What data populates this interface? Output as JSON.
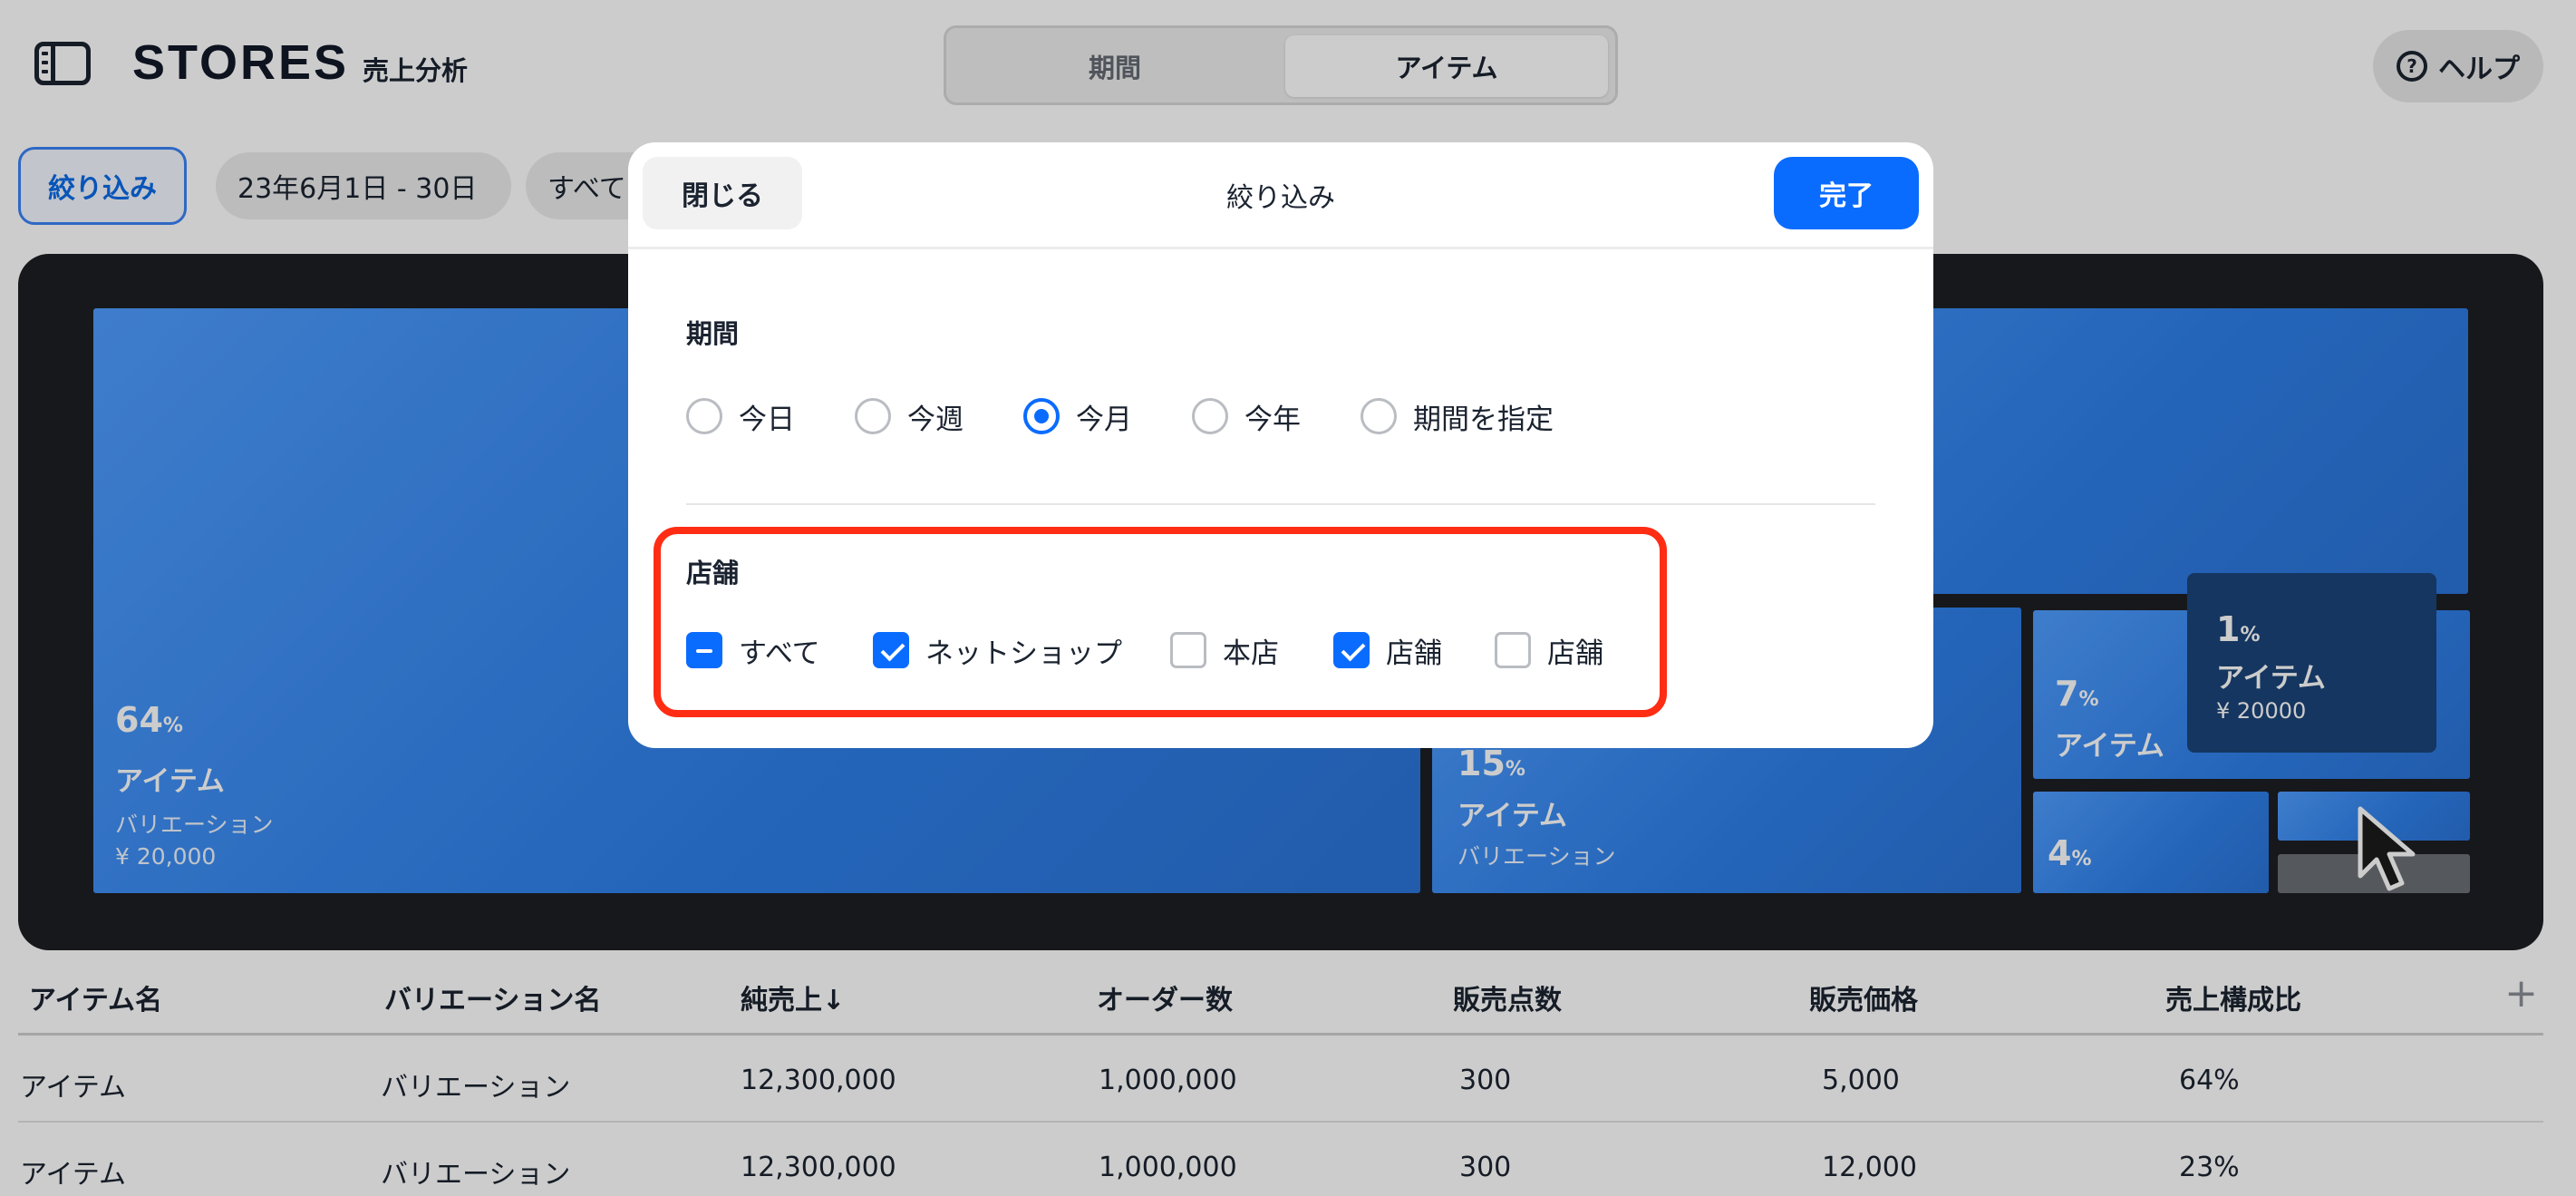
{
  "header": {
    "brand": "STORES",
    "subtitle": "売上分析",
    "segments": [
      "期間",
      "アイテム"
    ],
    "active_segment": "アイテム",
    "help_label": "ヘルプ"
  },
  "filters": {
    "filter_button": "絞り込み",
    "date_chip": "23年6月1日 - 30日",
    "store_chip": "すべて"
  },
  "treemap": {
    "tiles": [
      {
        "pct": "64",
        "unit": "%",
        "name": "アイテム",
        "variation": "バリエーション",
        "price": "¥ 20,000"
      },
      {
        "pct": "15",
        "unit": "%",
        "name": "アイテム",
        "variation": "バリエーション"
      },
      {
        "pct": "7",
        "unit": "%",
        "name": "アイテム"
      },
      {
        "pct": "4",
        "unit": "%"
      }
    ],
    "tooltip": {
      "pct": "1",
      "unit": "%",
      "name": "アイテム",
      "price": "¥ 20000"
    }
  },
  "table": {
    "columns": [
      "アイテム名",
      "バリエーション名",
      "純売上↓",
      "オーダー数",
      "販売点数",
      "販売価格",
      "売上構成比"
    ],
    "add_column": "+",
    "rows": [
      [
        "アイテム",
        "バリエーション",
        "12,300,000",
        "1,000,000",
        "300",
        "5,000",
        "64%"
      ],
      [
        "アイテム",
        "バリエーション",
        "12,300,000",
        "1,000,000",
        "300",
        "12,000",
        "23%"
      ]
    ]
  },
  "modal": {
    "close_label": "閉じる",
    "title": "絞り込み",
    "done_label": "完了",
    "period": {
      "label": "期間",
      "options": [
        "今日",
        "今週",
        "今月",
        "今年",
        "期間を指定"
      ],
      "selected": "今月"
    },
    "stores": {
      "label": "店舗",
      "options": [
        {
          "label": "すべて",
          "state": "mixed"
        },
        {
          "label": "ネットショップ",
          "state": "checked"
        },
        {
          "label": "本店",
          "state": "unchecked"
        },
        {
          "label": "店舗",
          "state": "checked"
        },
        {
          "label": "店舗",
          "state": "unchecked"
        }
      ]
    }
  },
  "colors": {
    "accent": "#0a6cff",
    "highlight": "#ff2d14",
    "treemap_bg": "#1d1f23"
  }
}
